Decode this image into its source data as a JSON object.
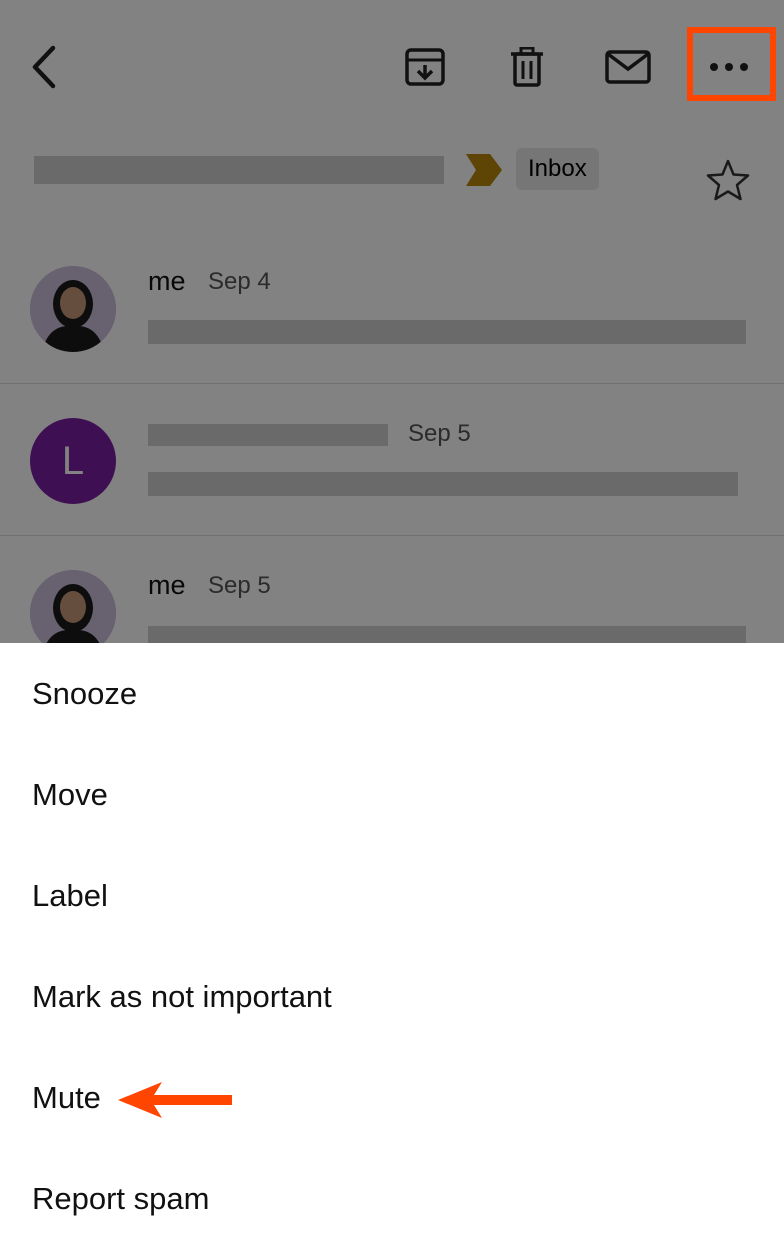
{
  "toolbar": {
    "back_icon": "chevron-left-icon",
    "archive_icon": "archive-icon",
    "delete_icon": "trash-icon",
    "mark_unread_icon": "envelope-icon",
    "more_icon": "more-horizontal-icon",
    "highlight_color": "#ff4500"
  },
  "thread": {
    "label_chip": "Inbox",
    "important_marker_color": "#b8860b",
    "star_icon": "star-outline-icon",
    "messages": [
      {
        "sender": "me",
        "date": "Sep 4",
        "avatar": "photo"
      },
      {
        "sender": "",
        "date": "Sep 5",
        "avatar_letter": "L",
        "avatar_color": "#7a1fa2"
      },
      {
        "sender": "me",
        "date": "Sep 5",
        "avatar": "photo"
      }
    ]
  },
  "menu": {
    "items": [
      "Snooze",
      "Move",
      "Label",
      "Mark as not important",
      "Mute",
      "Report spam"
    ],
    "annotation_color": "#ff4500"
  }
}
